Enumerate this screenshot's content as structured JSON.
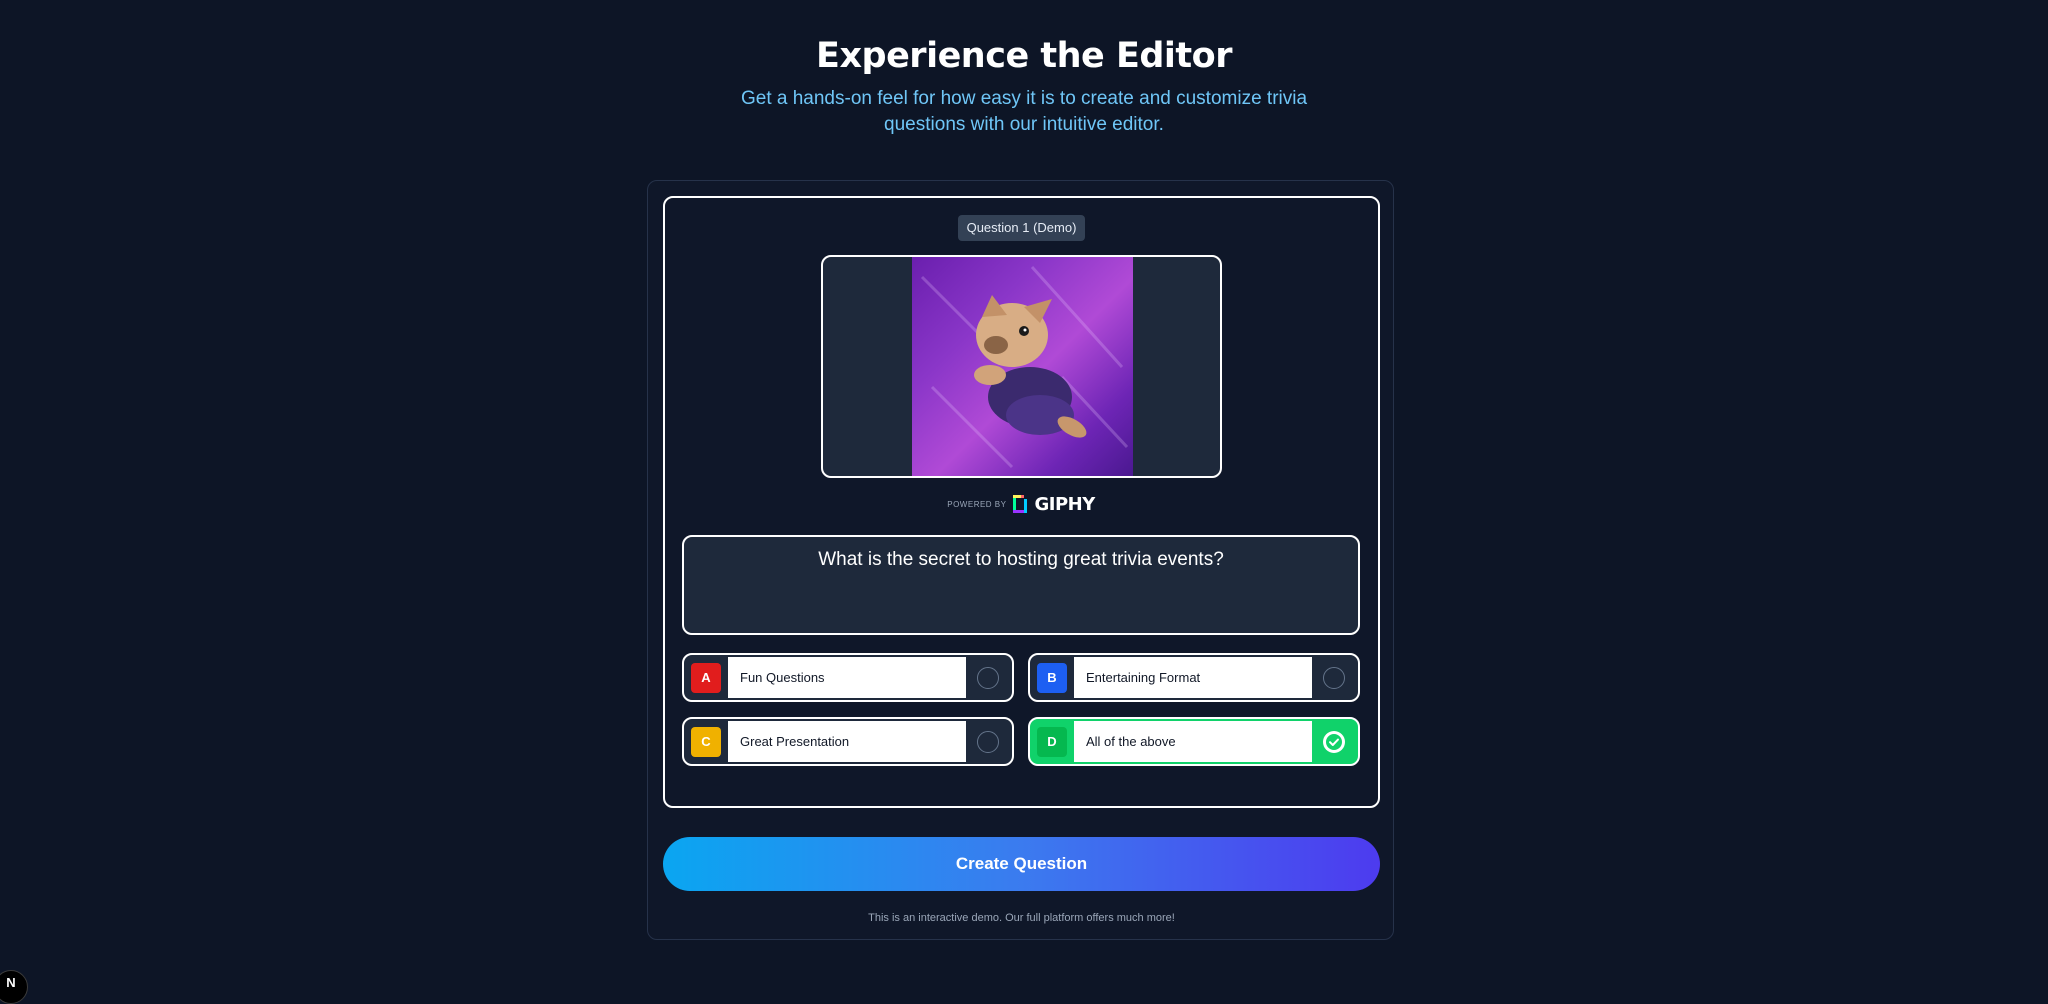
{
  "header": {
    "title": "Experience the Editor",
    "subtitle": "Get a hands-on feel for how easy it is to create and customize trivia questions with our intuitive editor."
  },
  "editor": {
    "question_badge": "Question 1 (Demo)",
    "media": {
      "icon": "gif-french-bulldog-flying"
    },
    "giphy": {
      "powered_by": "POWERED BY",
      "brand": "GIPHY"
    },
    "question_text": "What is the secret to hosting great trivia events?",
    "answers": [
      {
        "letter": "A",
        "text": "Fun Questions",
        "color": "#e11d1d",
        "correct": false
      },
      {
        "letter": "B",
        "text": "Entertaining Format",
        "color": "#1d5ff2",
        "correct": false
      },
      {
        "letter": "C",
        "text": "Great Presentation",
        "color": "#f0b100",
        "correct": false
      },
      {
        "letter": "D",
        "text": "All of the above",
        "color": "#05b84f",
        "correct": true
      }
    ]
  },
  "actions": {
    "create_label": "Create Question"
  },
  "footnote": "This is an interactive demo. Our full platform offers much more!",
  "dev_badge": {
    "letter": "N"
  },
  "colors": {
    "background": "#0d1526",
    "accent_subtitle": "#6fc6f7",
    "correct": "#10d26a",
    "button_gradient_start": "#0aa6f1",
    "button_gradient_end": "#4d3bef"
  }
}
